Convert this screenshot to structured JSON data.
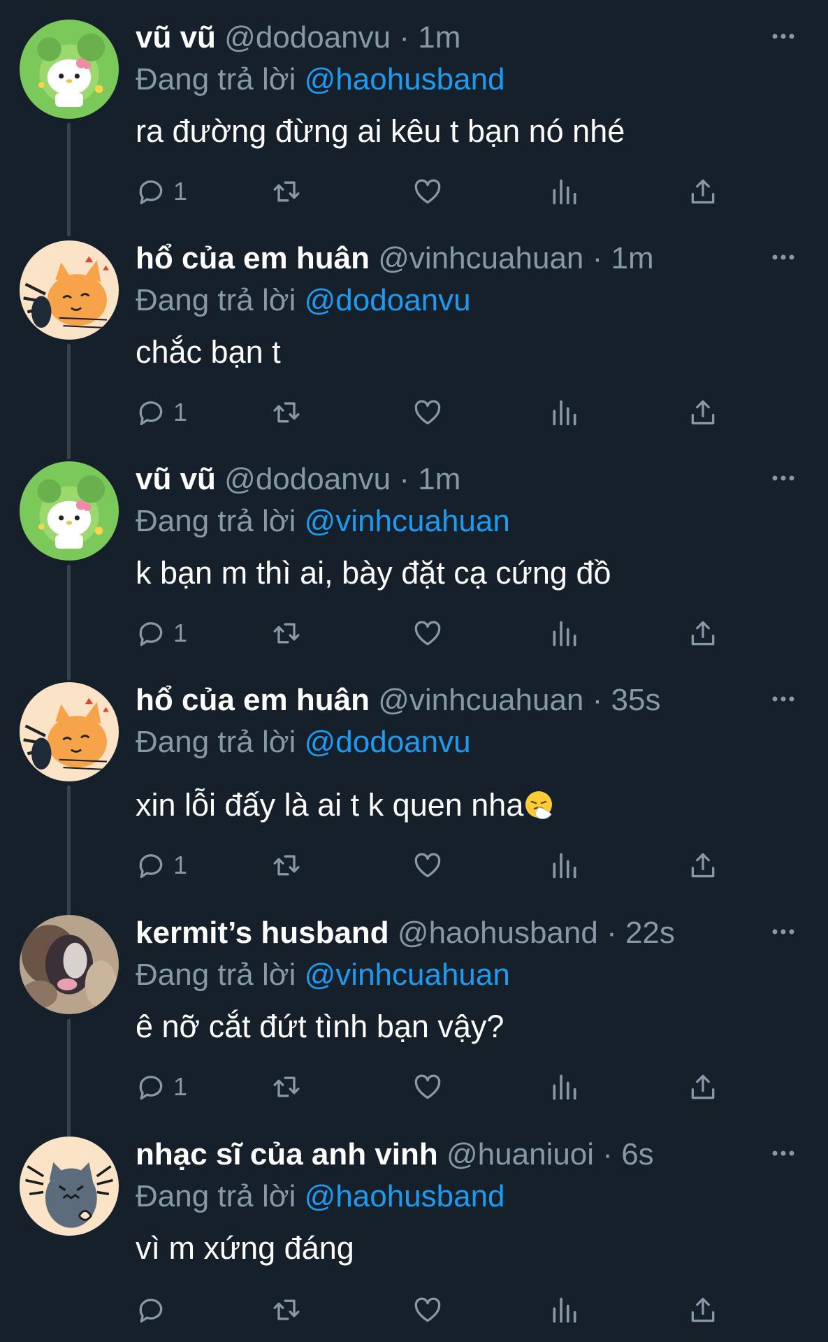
{
  "tweets": [
    {
      "display_name": "vũ vũ",
      "handle": "@dodoanvu",
      "time": "1m",
      "reply_prefix": "Đang trả lời",
      "reply_to": "@haohusband",
      "text": "ra đường đừng ai kêu t bạn nó nhé",
      "reply_count": "1",
      "avatar": "green-hello-kitty-avatar"
    },
    {
      "display_name": "hổ của em huân",
      "handle": "@vinhcuahuan",
      "time": "1m",
      "reply_prefix": "Đang trả lời",
      "reply_to": "@dodoanvu",
      "text": "chắc bạn t",
      "reply_count": "1",
      "avatar": "orange-cat-avatar"
    },
    {
      "display_name": "vũ vũ",
      "handle": "@dodoanvu",
      "time": "1m",
      "reply_prefix": "Đang trả lời",
      "reply_to": "@vinhcuahuan",
      "text": "k bạn m thì ai, bày đặt cạ cứng đồ",
      "reply_count": "1",
      "avatar": "green-hello-kitty-avatar"
    },
    {
      "display_name": "hổ của em huân",
      "handle": "@vinhcuahuan",
      "time": "35s",
      "reply_prefix": "Đang trả lời",
      "reply_to": "@dodoanvu",
      "text": "xin lỗi đấy là ai t k quen nha",
      "emoji": "sneezing-face-emoji",
      "reply_count": "1",
      "avatar": "orange-cat-avatar"
    },
    {
      "display_name": "kermit’s husband",
      "handle": "@haohusband",
      "time": "22s",
      "reply_prefix": "Đang trả lời",
      "reply_to": "@vinhcuahuan",
      "text": "ê nỡ cắt đứt tình bạn vậy?",
      "reply_count": "1",
      "avatar": "blurry-cat-photo-avatar"
    },
    {
      "display_name": "nhạc sĩ của anh vinh",
      "handle": "@huaniuoi",
      "time": "6s",
      "reply_prefix": "Đang trả lời",
      "reply_to": "@haohusband",
      "text": "vì m xứng đáng",
      "reply_count": "",
      "avatar": "grey-cat-doodle-avatar"
    }
  ],
  "separator": "·",
  "colors": {
    "background": "#15202b",
    "muted": "#8899a6",
    "mention": "#1d9bf0",
    "thread_line": "#38444d"
  },
  "icons": [
    "reply-icon",
    "retweet-icon",
    "like-icon",
    "analytics-icon",
    "share-icon",
    "more-options-icon"
  ]
}
